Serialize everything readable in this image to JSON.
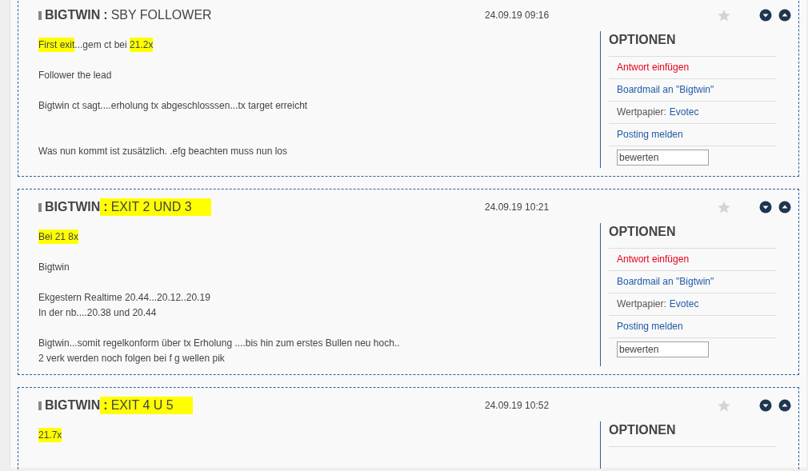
{
  "posts": [
    {
      "title": {
        "author": "BIGTWIN",
        "separator": ":",
        "subject": "SBY FOLLOWER",
        "highlighted": false
      },
      "date": "24.09.19 09:16",
      "body": [
        {
          "kind": "text",
          "segments": [
            {
              "text": "First exit",
              "highlighted": true
            },
            {
              "text": "...gem ct bei ",
              "highlighted": false
            },
            {
              "text": "21.2x",
              "highlighted": true
            }
          ]
        },
        {
          "kind": "blank"
        },
        {
          "kind": "text",
          "segments": [
            {
              "text": "Follower the lead",
              "highlighted": false
            }
          ]
        },
        {
          "kind": "blank"
        },
        {
          "kind": "text",
          "segments": [
            {
              "text": "Bigtwin ct sagt....erholung tx abgeschlosssen...tx target erreicht",
              "highlighted": false
            }
          ]
        },
        {
          "kind": "blank"
        },
        {
          "kind": "blank"
        },
        {
          "kind": "text",
          "segments": [
            {
              "text": "Was nun kommt ist zusätzlich. .efg beachten muss nun los",
              "highlighted": false
            }
          ]
        }
      ],
      "options": {
        "heading": "OPTIONEN",
        "items": [
          {
            "kind": "reply",
            "text": "Antwort einfügen"
          },
          {
            "kind": "link",
            "text": "Boardmail an \"Bigtwin\""
          },
          {
            "kind": "security",
            "label": "Wertpapier:",
            "link": "Evotec"
          },
          {
            "kind": "link",
            "text": "Posting melden"
          }
        ],
        "rating": {
          "value": "bewerten"
        }
      }
    },
    {
      "title": {
        "author": "BIGTWIN",
        "separator": ":",
        "subject": "EXIT 2 UND 3",
        "highlighted": true
      },
      "date": "24.09.19 10:21",
      "body": [
        {
          "kind": "text",
          "segments": [
            {
              "text": "Bei 21 8x",
              "highlighted": true
            }
          ]
        },
        {
          "kind": "blank"
        },
        {
          "kind": "text",
          "segments": [
            {
              "text": "Bigtwin",
              "highlighted": false
            }
          ]
        },
        {
          "kind": "blank"
        },
        {
          "kind": "text",
          "segments": [
            {
              "text": "Ekgestern Realtime 20.44...20.12..20.19",
              "highlighted": false
            }
          ]
        },
        {
          "kind": "text",
          "segments": [
            {
              "text": "In der nb....20.38 und 20.44",
              "highlighted": false
            }
          ]
        },
        {
          "kind": "blank"
        },
        {
          "kind": "text",
          "segments": [
            {
              "text": "Bigtwin...somit regelkonform über tx Erholung ....bis hin zum erstes Bullen neu hoch..",
              "highlighted": false
            }
          ]
        },
        {
          "kind": "text",
          "segments": [
            {
              "text": "2 verk werden noch folgen bei  f g wellen pik",
              "highlighted": false
            }
          ]
        }
      ],
      "options": {
        "heading": "OPTIONEN",
        "items": [
          {
            "kind": "reply",
            "text": "Antwort einfügen"
          },
          {
            "kind": "link",
            "text": "Boardmail an \"Bigtwin\""
          },
          {
            "kind": "security",
            "label": "Wertpapier:",
            "link": "Evotec"
          },
          {
            "kind": "link",
            "text": "Posting melden"
          }
        ],
        "rating": {
          "value": "bewerten"
        }
      }
    },
    {
      "title": {
        "author": "BIGTWIN",
        "separator": ":",
        "subject": "EXIT 4 U 5",
        "highlighted": true
      },
      "date": "24.09.19 10:52",
      "body": [
        {
          "kind": "text",
          "segments": [
            {
              "text": "21.7x",
              "highlighted": true
            }
          ]
        }
      ],
      "options": {
        "heading": "OPTIONEN"
      }
    }
  ]
}
